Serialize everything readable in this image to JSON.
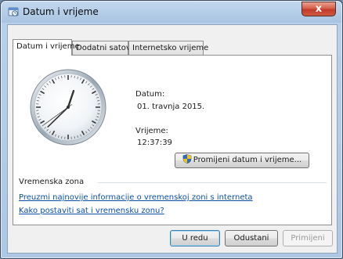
{
  "window": {
    "title": "Datum i vrijeme",
    "close_glyph": "x"
  },
  "tabs": [
    {
      "label": "Datum i vrijeme",
      "active": true
    },
    {
      "label": "Dodatni satovi",
      "active": false
    },
    {
      "label": "Internetsko vrijeme",
      "active": false
    }
  ],
  "date": {
    "label": "Datum:",
    "value": "01. travnja 2015."
  },
  "time": {
    "label": "Vrijeme:",
    "value": "12:37:39"
  },
  "change_button": {
    "label": "Promijeni datum i vrijeme..."
  },
  "timezone": {
    "section_label": "Vremenska zona",
    "link_download": "Preuzmi najnovije informacije o vremenskoj zoni s interneta",
    "link_howto": "Kako postaviti sat i vremensku zonu?"
  },
  "footer": {
    "ok": "U redu",
    "cancel": "Odustani",
    "apply": "Primijeni"
  },
  "colors": {
    "link": "#0b4fa8",
    "close": "#c2392a",
    "title_bar": "#b9d0ea"
  }
}
